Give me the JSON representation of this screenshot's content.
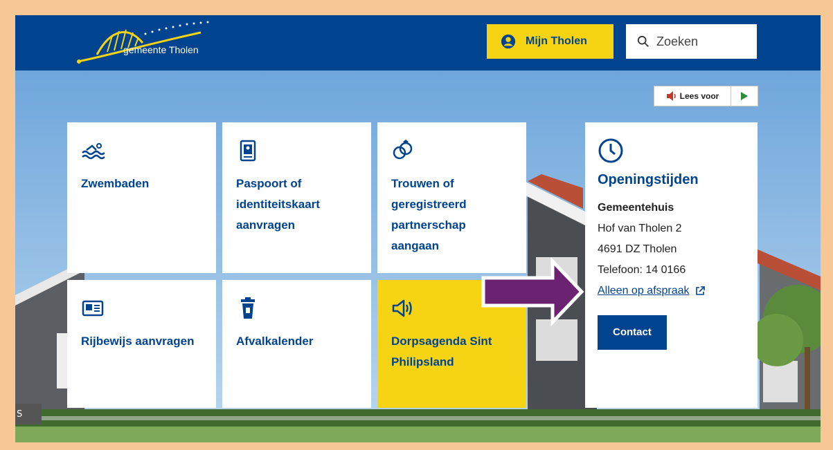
{
  "header": {
    "logo_text": "gemeente Tholen",
    "mijn_label": "Mijn Tholen",
    "search_placeholder": "Zoeken"
  },
  "read_aloud": {
    "label": "Lees voor"
  },
  "tiles": [
    {
      "label": "Zwembaden",
      "icon": "swimming-icon"
    },
    {
      "label": "Paspoort of identiteitskaart aanvragen",
      "icon": "passport-icon"
    },
    {
      "label": "Trouwen of geregistreerd partnerschap aangaan",
      "icon": "rings-icon"
    },
    {
      "label": "Rijbewijs aanvragen",
      "icon": "id-card-icon"
    },
    {
      "label": "Afvalkalender",
      "icon": "waste-bin-icon"
    },
    {
      "label": "Dorpsagenda Sint Philipsland",
      "icon": "megaphone-icon"
    }
  ],
  "opening": {
    "title": "Openingstijden",
    "location": "Gemeentehuis",
    "address1": "Hof van Tholen 2",
    "address2": "4691 DZ Tholen",
    "phone": "Telefoon: 14 0166",
    "appointment_link": "Alleen op afspraak",
    "contact_label": "Contact"
  },
  "corner_badge": "S",
  "colors": {
    "primary": "#00438f",
    "accent": "#f6d313",
    "frame": "#f7c896",
    "arrow": "#6b2270"
  }
}
